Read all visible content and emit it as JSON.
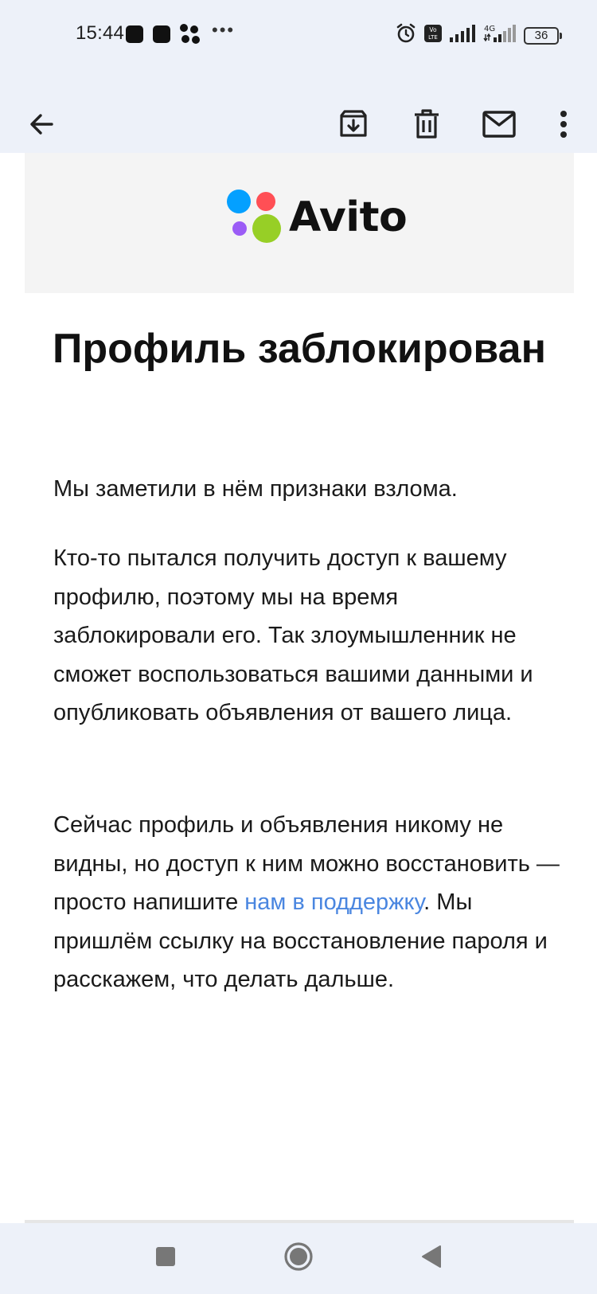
{
  "status_bar": {
    "time": "15:44",
    "network_label": "4G",
    "volte_label": "Vo LTE",
    "battery_level": "36"
  },
  "app_bar": {
    "icons": [
      "back-arrow-icon",
      "archive-icon",
      "delete-icon",
      "mail-icon",
      "more-vert-icon"
    ]
  },
  "email": {
    "logo_text": "Avito",
    "title": "Профиль заблокирован",
    "paragraph_1": "Мы заметили в нём признаки взлома.",
    "paragraph_2": "Кто-то пытался получить доступ к вашему профилю, поэтому мы на время заблокировали его. Так злоумышленник не сможет воспользоваться вашими данными и опубликовать объявления от вашего лица.",
    "paragraph_3_before_link": "Сейчас профиль и объявления никому не видны, но доступ к ним можно восстановить — просто напишите ",
    "paragraph_3_link": "нам в поддержку",
    "paragraph_3_after_link": ". Мы пришлём ссылку на восстановление пароля и расскажем, что делать дальше."
  },
  "colors": {
    "background": "#edf1f9",
    "link": "#4a86e0",
    "logo_blue": "#04a0ff",
    "logo_red": "#ff4f55",
    "logo_purple": "#9b5cf6",
    "logo_green": "#97cf26"
  },
  "nav_bar": {
    "icons": [
      "recents-square-icon",
      "home-circle-icon",
      "back-triangle-icon"
    ]
  }
}
